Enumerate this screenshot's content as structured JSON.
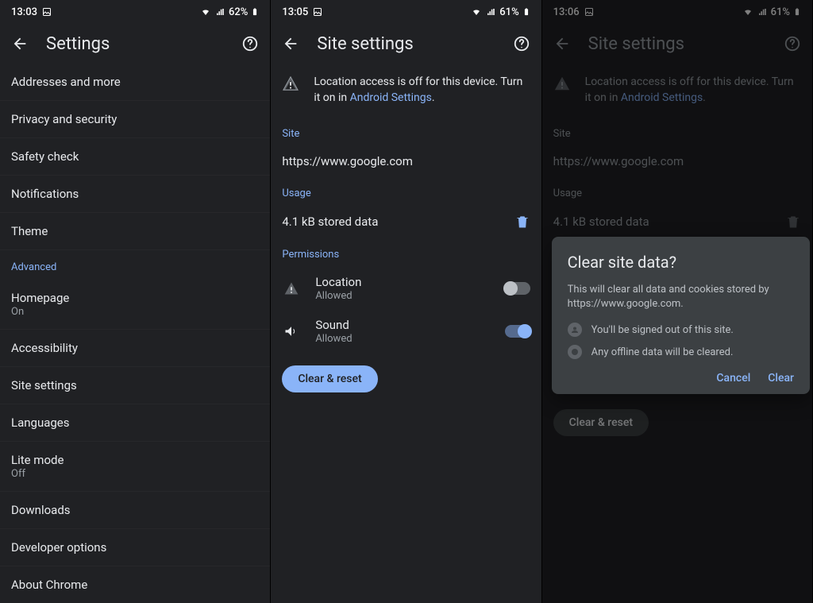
{
  "panel1": {
    "status": {
      "time": "13:03",
      "battery": "62%"
    },
    "title": "Settings",
    "items": [
      {
        "label": "Addresses and more",
        "sub": ""
      },
      {
        "label": "Privacy and security",
        "sub": ""
      },
      {
        "label": "Safety check",
        "sub": ""
      },
      {
        "label": "Notifications",
        "sub": ""
      },
      {
        "label": "Theme",
        "sub": ""
      }
    ],
    "advanced_header": "Advanced",
    "adv_items": [
      {
        "label": "Homepage",
        "sub": "On"
      },
      {
        "label": "Accessibility",
        "sub": ""
      },
      {
        "label": "Site settings",
        "sub": ""
      },
      {
        "label": "Languages",
        "sub": ""
      },
      {
        "label": "Lite mode",
        "sub": "Off"
      },
      {
        "label": "Downloads",
        "sub": ""
      },
      {
        "label": "Developer options",
        "sub": ""
      },
      {
        "label": "About Chrome",
        "sub": ""
      }
    ]
  },
  "panel2": {
    "status": {
      "time": "13:05",
      "battery": "61%"
    },
    "title": "Site settings",
    "warning_pre": "Location access is off for this device. Turn it on in ",
    "warning_link": "Android Settings",
    "warning_post": ".",
    "site_header": "Site",
    "site_url": "https://www.google.com",
    "usage_header": "Usage",
    "usage_text": "4.1 kB stored data",
    "perm_header": "Permissions",
    "perms": [
      {
        "title": "Location",
        "sub": "Allowed",
        "on": false
      },
      {
        "title": "Sound",
        "sub": "Allowed",
        "on": true
      }
    ],
    "clear_button": "Clear & reset"
  },
  "panel3": {
    "status": {
      "time": "13:06",
      "battery": "61%"
    },
    "title": "Site settings",
    "warning_pre": "Location access is off for this device. Turn it on in ",
    "warning_link": "Android Settings",
    "warning_post": ".",
    "site_header": "Site",
    "site_url": "https://www.google.com",
    "usage_header": "Usage",
    "usage_text": "4.1 kB stored data",
    "clear_button": "Clear & reset",
    "dialog": {
      "title": "Clear site data?",
      "body": "This will clear all data and cookies stored by https://www.google.com.",
      "bullets": [
        "You'll be signed out of this site.",
        "Any offline data will be cleared."
      ],
      "cancel": "Cancel",
      "clear": "Clear"
    }
  }
}
